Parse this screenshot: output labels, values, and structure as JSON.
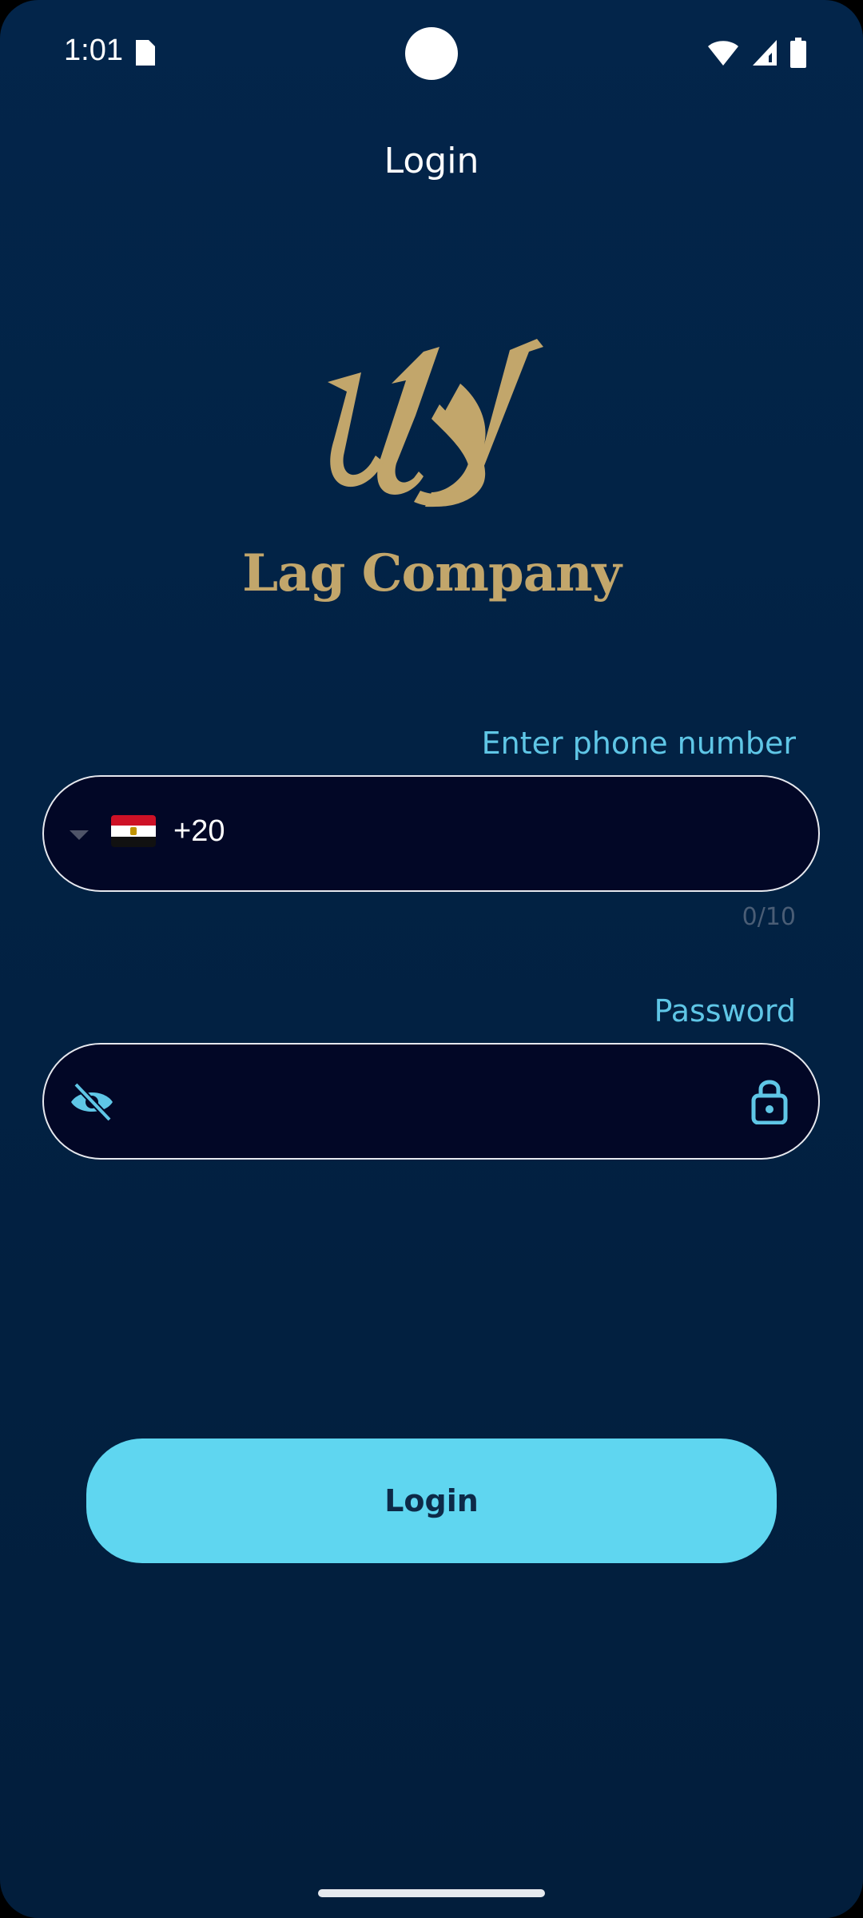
{
  "status_bar": {
    "time": "1:01",
    "icons": [
      "sim-card-icon",
      "wifi-icon",
      "signal-icon",
      "battery-icon"
    ]
  },
  "header": {
    "title": "Login"
  },
  "logo": {
    "name": "Lag Company",
    "icon": "lag-logo-mark",
    "color": "#c2a66b"
  },
  "phone_field": {
    "label": "Enter phone number",
    "country_flag": "egypt-flag-icon",
    "dial_code": "+20",
    "value": "",
    "counter": "0/10"
  },
  "password_field": {
    "label": "Password",
    "value": "",
    "toggle_icon": "eye-off-icon",
    "lock_icon": "lock-icon"
  },
  "actions": {
    "login_label": "Login"
  },
  "colors": {
    "background": "#022244",
    "accent": "#5fd6f0",
    "label": "#5fc6e6",
    "field_bg": "#020726"
  }
}
